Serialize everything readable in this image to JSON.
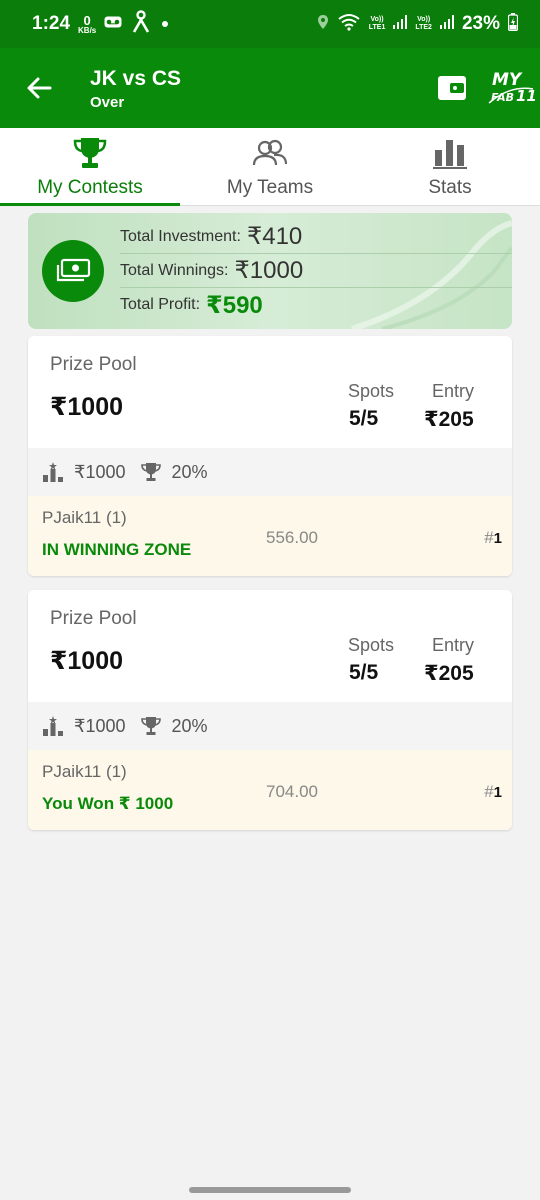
{
  "status_bar": {
    "time": "1:24",
    "net_speed_value": "0",
    "net_speed_unit": "KB/s",
    "sim1": "Vo))\nLTE1",
    "sim2": "Vo))\nLTE2",
    "battery": "23%"
  },
  "header": {
    "title": "JK vs CS",
    "status": "Over",
    "back_icon": "arrow-left-icon",
    "wallet_icon": "wallet-icon",
    "logo_text": "MY FAB 11"
  },
  "tabs": [
    {
      "label": "My Contests",
      "icon": "trophy-icon",
      "active": true
    },
    {
      "label": "My Teams",
      "icon": "users-icon",
      "active": false
    },
    {
      "label": "Stats",
      "icon": "bar-chart-icon",
      "active": false
    }
  ],
  "summary": {
    "investment_label": "Total Investment:",
    "investment_value": "₹410",
    "winnings_label": "Total Winnings:",
    "winnings_value": "₹1000",
    "profit_label": "Total Profit:",
    "profit_value": "₹590"
  },
  "contests": [
    {
      "prize_pool_label": "Prize Pool",
      "prize_pool": "₹1000",
      "spots_label": "Spots",
      "spots": "5/5",
      "entry_label": "Entry",
      "entry": "₹205",
      "first_prize": "₹1000",
      "win_percent": "20%",
      "team_name": "PJaik11 (1)",
      "team_status": "IN WINNING ZONE",
      "points": "556.00",
      "rank_hash": "#",
      "rank": "1"
    },
    {
      "prize_pool_label": "Prize Pool",
      "prize_pool": "₹1000",
      "spots_label": "Spots",
      "spots": "5/5",
      "entry_label": "Entry",
      "entry": "₹205",
      "first_prize": "₹1000",
      "win_percent": "20%",
      "team_name": "PJaik11 (1)",
      "team_status": "You Won ₹ 1000",
      "points": "704.00",
      "rank_hash": "#",
      "rank": "1"
    }
  ],
  "colors": {
    "primary": "#0a8a0a",
    "status_bar": "#0a7d0a",
    "team_row_bg": "#fdf8ea"
  }
}
